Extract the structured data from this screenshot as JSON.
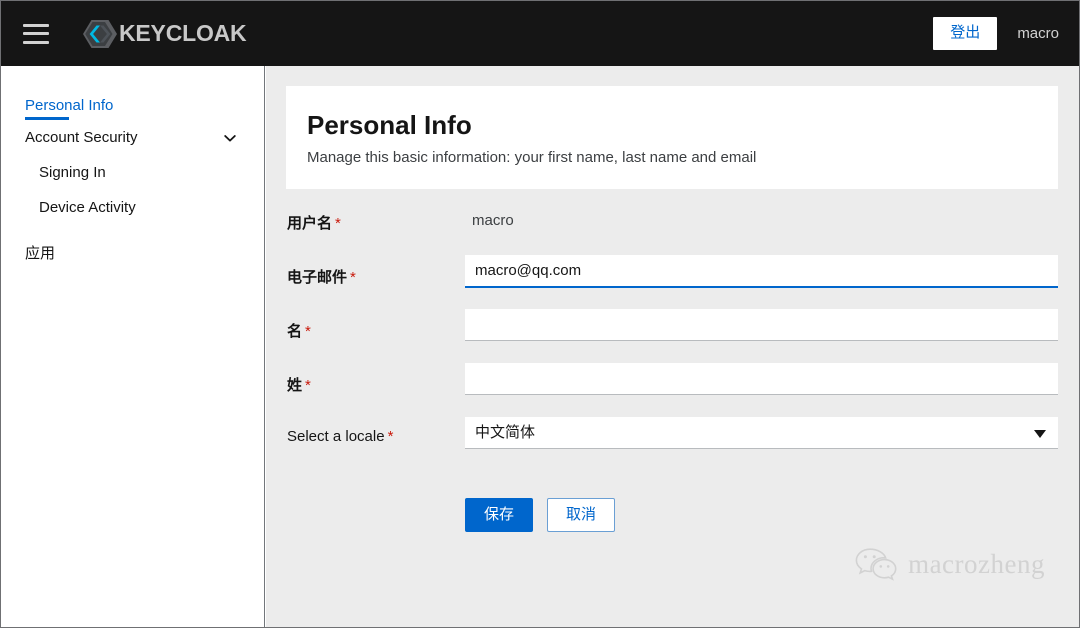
{
  "masthead": {
    "menu_icon": "hamburger-icon",
    "brand_name": "KEYCLOAK",
    "brand_logo_icon": "keycloak-hexagon-logo",
    "signout_label": "登出",
    "username": "macro"
  },
  "sidebar": {
    "items": [
      {
        "label": "Personal Info",
        "state": "active",
        "icon": null
      },
      {
        "label": "Account Security",
        "state": "expanded",
        "icon": "chevron-down-icon"
      },
      {
        "label": "Signing In",
        "state": "sub"
      },
      {
        "label": "Device Activity",
        "state": "sub"
      },
      {
        "label": "应用",
        "state": "normal"
      }
    ]
  },
  "page": {
    "title": "Personal Info",
    "subtitle": "Manage this basic information: your first name, last name and email"
  },
  "form": {
    "required_mark": "*",
    "fields": [
      {
        "label": "用户名",
        "required": true,
        "type": "static",
        "value": "macro"
      },
      {
        "label": "电子邮件",
        "required": true,
        "type": "text",
        "value": "macro@qq.com",
        "placeholder": "",
        "focused": true
      },
      {
        "label": "名",
        "required": true,
        "type": "text",
        "value": "",
        "placeholder": "",
        "focused": false
      },
      {
        "label": "姓",
        "required": true,
        "type": "text",
        "value": "",
        "placeholder": "",
        "focused": false
      },
      {
        "label": "Select a locale",
        "required": true,
        "type": "select",
        "value": "中文简体",
        "caret_icon": "caret-down-icon"
      }
    ],
    "save_label": "保存",
    "cancel_label": "取消"
  },
  "watermark": {
    "icon": "wechat-icon",
    "text": "macrozheng"
  },
  "colors": {
    "masthead_bg": "#151515",
    "accent_blue": "#0066cc",
    "required_red": "#c9190b",
    "content_bg": "#ececec",
    "card_bg": "#ffffff"
  }
}
